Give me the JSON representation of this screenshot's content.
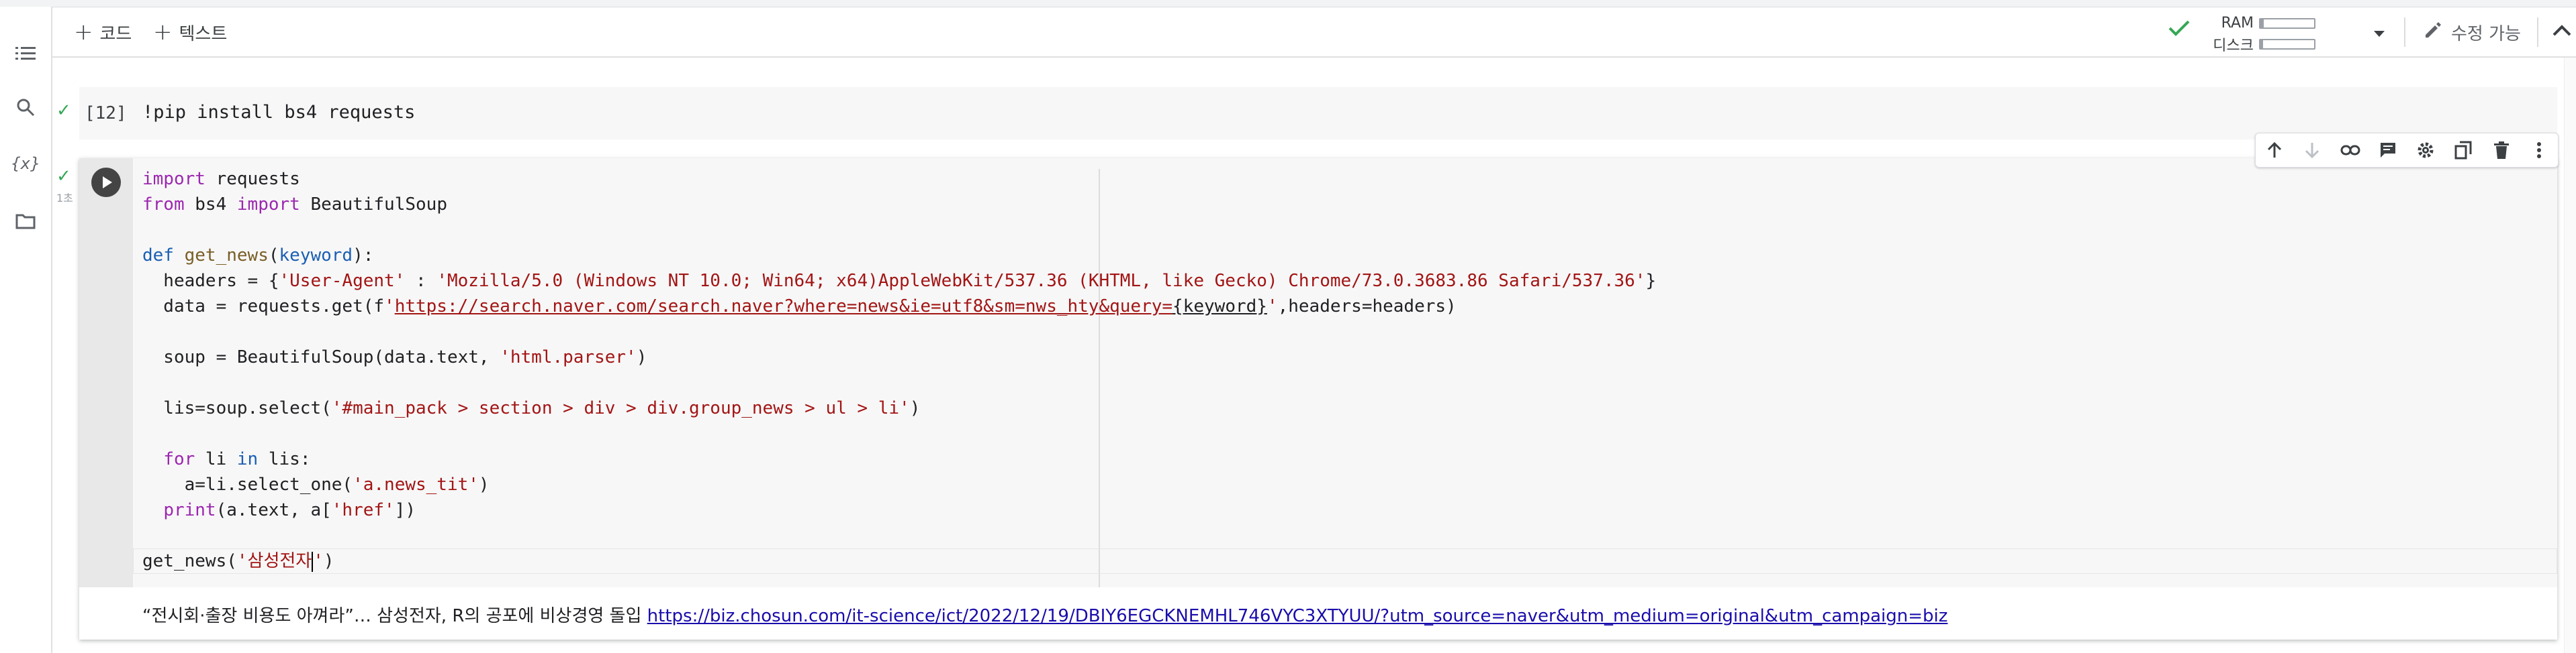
{
  "toolbar": {
    "add_code_label": "코드",
    "add_text_label": "텍스트",
    "ram_label": "RAM",
    "disk_label": "디스크",
    "ram_usage": 0.06,
    "disk_usage": 0.05,
    "edit_label": "수정 가능"
  },
  "sidebar": {
    "items": [
      {
        "icon": "table-of-contents-icon"
      },
      {
        "icon": "search-icon"
      },
      {
        "icon": "variables-icon",
        "glyph": "{x}"
      },
      {
        "icon": "folder-icon"
      }
    ]
  },
  "cell1": {
    "exec_count": "[12]",
    "command": "!pip install bs4 requests"
  },
  "cell2": {
    "timing": "1초",
    "lines": [
      [
        "import requests"
      ],
      [
        "from bs4 import BeautifulSoup"
      ],
      [
        ""
      ],
      [
        "def get_news(keyword):"
      ],
      [
        "  headers = {'User-Agent' : 'Mozilla/5.0 (Windows NT 10.0; Win64; x64)AppleWebKit/537.36 (KHTML, like Gecko) Chrome/73.0.3683.86 Safari/537.36'}"
      ],
      [
        "  data = requests.get(f'https://search.naver.com/search.naver?where=news&ie=utf8&sm=nws_hty&query={keyword}',headers=headers)"
      ],
      [
        ""
      ],
      [
        "  soup = BeautifulSoup(data.text, 'html.parser')"
      ],
      [
        ""
      ],
      [
        "  lis=soup.select('#main_pack > section > div > div.group_news > ul > li')"
      ],
      [
        ""
      ],
      [
        "  for li in lis:"
      ],
      [
        "    a=li.select_one('a.news_tit')"
      ],
      [
        "  print(a.text, a['href'])"
      ],
      [
        ""
      ],
      [
        "get_news('삼성전자')"
      ]
    ],
    "output_text": "“전시회·출장 비용도 아껴라”… 삼성전자, R의 공포에 비상경영 돌입 ",
    "output_link": "https://biz.chosun.com/it-science/ict/2022/12/19/DBIY6EGCKNEMHL746VYC3XTYUU/?utm_source=naver&utm_medium=original&utm_campaign=biz"
  },
  "colors": {
    "keyword": "#9c27b0",
    "def_keyword": "#1a5fb4",
    "string": "#a31515",
    "function": "#795e26",
    "link": "#1a0dab",
    "check": "#34a853"
  }
}
